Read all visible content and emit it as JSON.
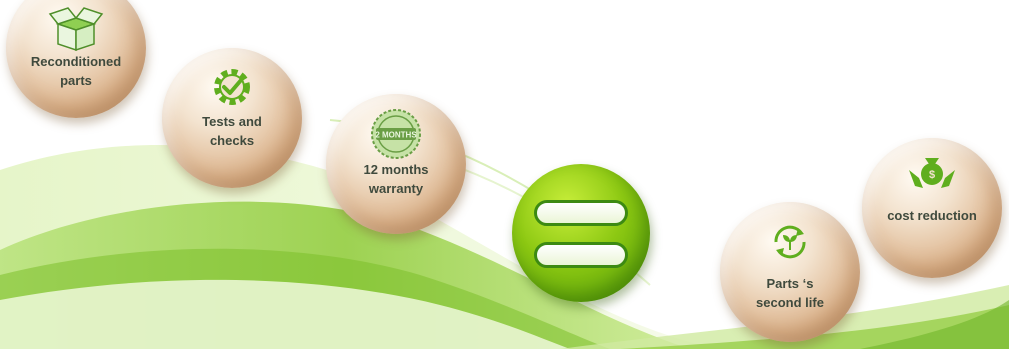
{
  "headline": "",
  "items": [
    {
      "label": "Reconditioned\nparts",
      "icon": "open-box-icon"
    },
    {
      "label": "Tests and\nchecks",
      "icon": "gear-checkmark-icon"
    },
    {
      "label": "12 months\nwarranty",
      "icon": "warranty-stamp-icon"
    },
    {
      "label": "cost reduction",
      "icon": "money-bag-hands-icon"
    },
    {
      "label": "Parts ‘s\nsecond life",
      "icon": "recycle-sprout-icon"
    }
  ],
  "stamp_text": "2 MONTHS",
  "colors": {
    "accent_green": "#5fae1e",
    "bubble_tan": "#ddb58e",
    "label_text": "#3f4a3d"
  }
}
